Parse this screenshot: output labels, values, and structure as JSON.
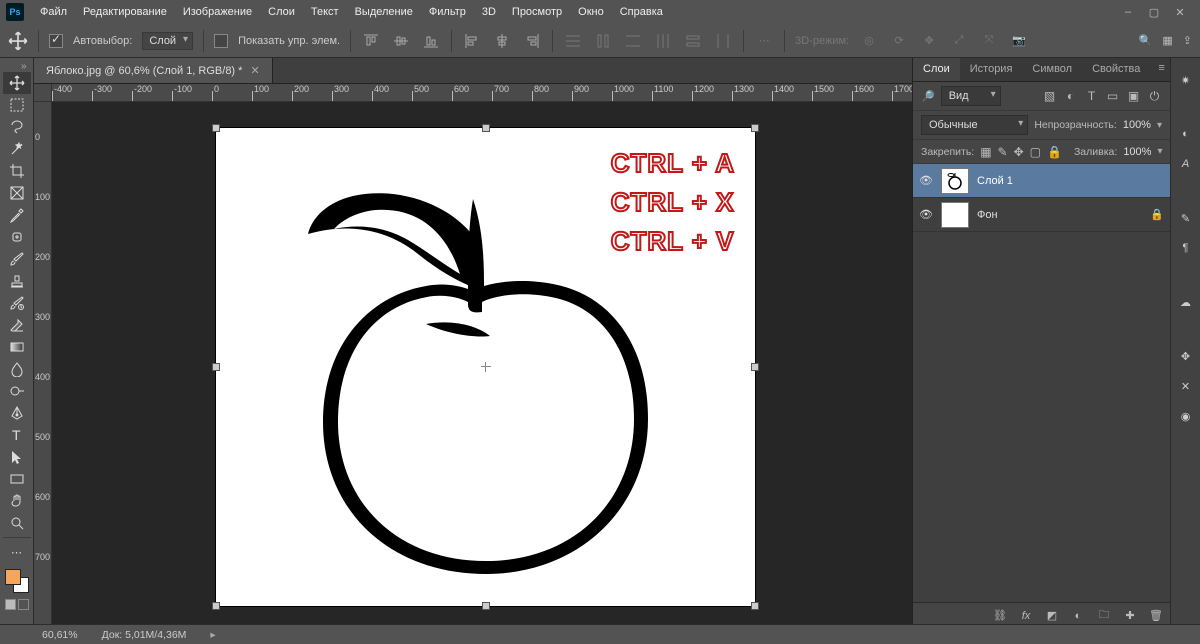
{
  "menubar": {
    "items": [
      "Файл",
      "Редактирование",
      "Изображение",
      "Слои",
      "Текст",
      "Выделение",
      "Фильтр",
      "3D",
      "Просмотр",
      "Окно",
      "Справка"
    ]
  },
  "optbar": {
    "auto_select_label": "Автовыбор:",
    "scope_dd": "Слой",
    "show_controls_label": "Показать упр. элем.",
    "mode3d_label": "3D-режим:"
  },
  "doc": {
    "tab_title": "Яблоко.jpg @ 60,6% (Слой 1, RGB/8) *"
  },
  "ruler": {
    "h": [
      "-400",
      "-300",
      "-200",
      "-100",
      "0",
      "100",
      "200",
      "300",
      "400",
      "500",
      "600",
      "700",
      "800",
      "900",
      "1000",
      "1100",
      "1200",
      "1300",
      "1400",
      "1500",
      "1600",
      "1700"
    ],
    "v": [
      "0",
      "100",
      "200",
      "300",
      "400",
      "500",
      "600",
      "700"
    ]
  },
  "canvas_text": {
    "line1": "CTRL + A",
    "line2": "CTRL + X",
    "line3": "CTRL + V"
  },
  "panels": {
    "tabs": [
      "Слои",
      "История",
      "Символ",
      "Свойства"
    ],
    "search_dd": "Вид",
    "blend_dd": "Обычные",
    "opacity_label": "Непрозрачность:",
    "opacity_value": "100%",
    "lock_label": "Закрепить:",
    "fill_label": "Заливка:",
    "fill_value": "100%",
    "layers": [
      {
        "name": "Слой 1",
        "selected": true,
        "thumb": "apple",
        "locked": false
      },
      {
        "name": "Фон",
        "selected": false,
        "thumb": "white",
        "locked": true
      }
    ]
  },
  "status": {
    "zoom": "60,61%",
    "docinfo": "Док: 5,01M/4,36M"
  }
}
